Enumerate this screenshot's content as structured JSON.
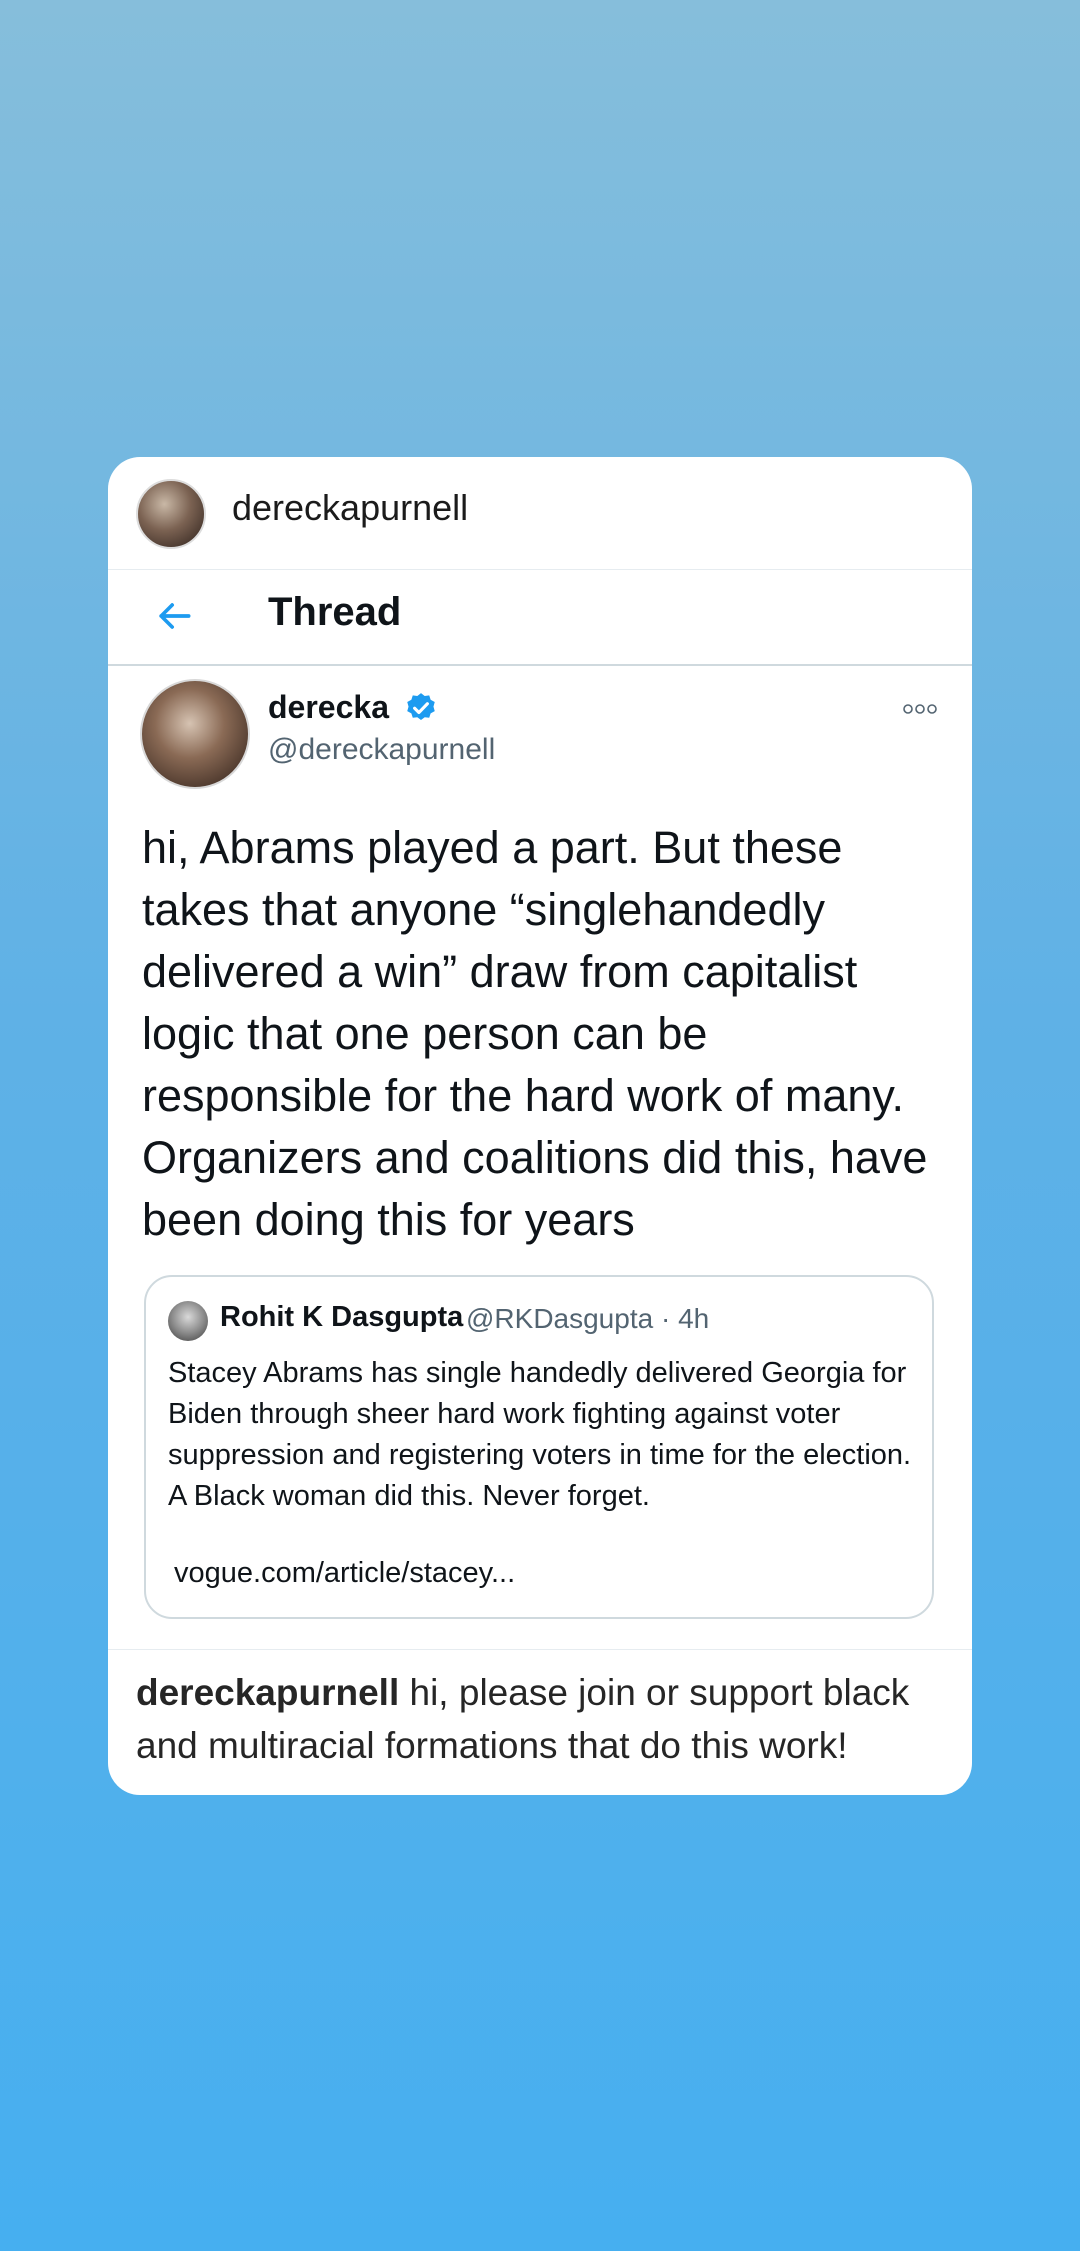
{
  "post": {
    "username": "dereckapurnell"
  },
  "thread_bar": {
    "title": "Thread"
  },
  "tweet": {
    "display_name": "derecka",
    "handle": "@dereckapurnell",
    "text": "hi, Abrams played a part. But these takes that anyone “singlehandedly delivered a win” draw from capitalist logic that one person can be responsible for the hard work of many. Organizers and coalitions did this, have been doing this for years"
  },
  "quoted_tweet": {
    "display_name": "Rohit K Dasgupta",
    "handle_time": "@RKDasgupta · 4h",
    "text": "Stacey Abrams has single handedly delivered Georgia for Biden through sheer hard work fighting against voter suppression and registering voters in time for the election. A Black woman did this. Never forget.",
    "link": "vogue.com/article/stacey..."
  },
  "caption": {
    "username": "dereckapurnell",
    "text": " hi, please join or support black and multiracial formations that do this work!"
  },
  "icons": {
    "back": "arrow-left-icon",
    "verified": "verified-badge-icon",
    "more": "more-options-icon"
  },
  "colors": {
    "twitter_blue": "#1d9bf0",
    "background_top": "#86bedb",
    "background_bottom": "#46aff0"
  }
}
